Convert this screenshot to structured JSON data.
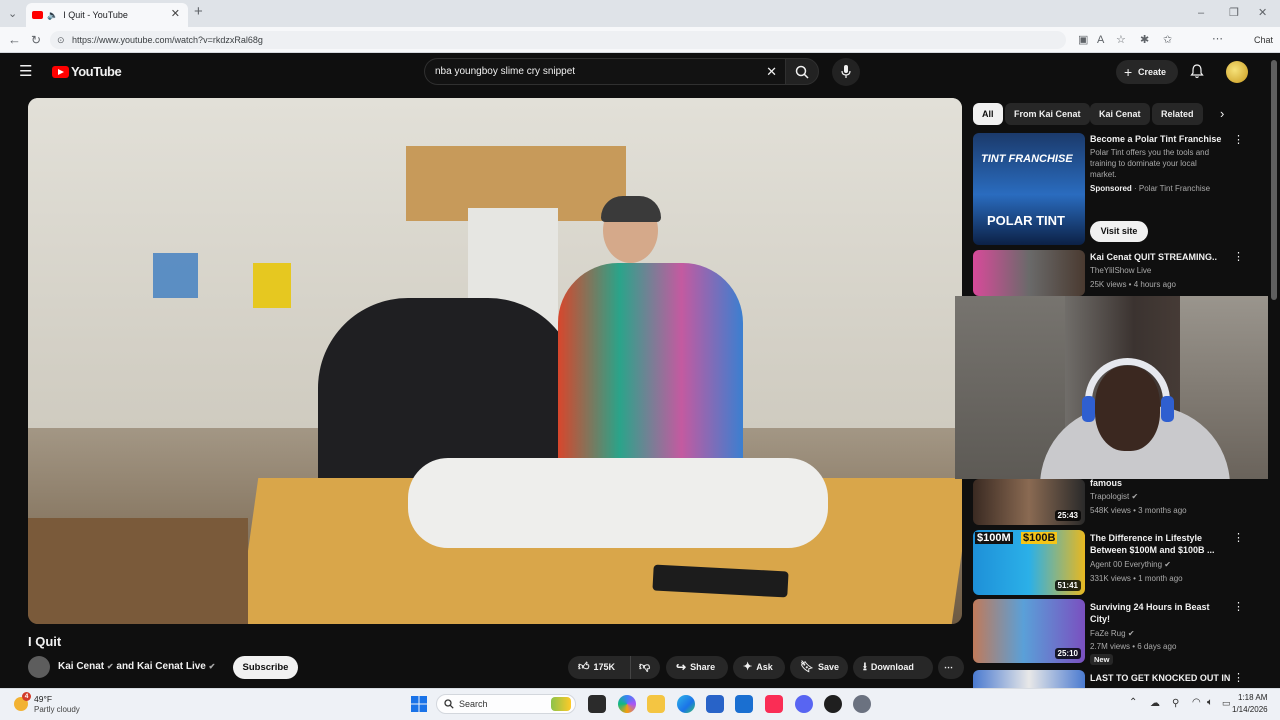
{
  "browser": {
    "tab_title": "I Quit - YouTube",
    "url": "https://www.youtube.com/watch?v=rkdzxRal68g",
    "copilot_label": "Chat"
  },
  "youtube": {
    "logo_text": "YouTube",
    "search_value": "nba youngboy slime cry snippet",
    "create_label": "Create"
  },
  "video": {
    "title": "I Quit",
    "channel": "Kai Cenat",
    "channel_joiner": "and",
    "channel2": "Kai Cenat Live",
    "subscribe_label": "Subscribe",
    "likes": "175K",
    "share_label": "Share",
    "ask_label": "Ask",
    "save_label": "Save",
    "download_label": "Download"
  },
  "chips": [
    "All",
    "From Kai Cenat",
    "Kai Cenat",
    "Related"
  ],
  "ad": {
    "title": "Become a Polar Tint Franchise",
    "description": "Polar Tint offers you the tools and training to dominate your local market.",
    "sponsored": "Sponsored",
    "advertiser": "Polar Tint Franchise",
    "cta": "Visit site",
    "thumb_text_top": "TINT FRANCHISE",
    "thumb_text_bottom": "POLAR TINT"
  },
  "related": [
    {
      "title": "Kai Cenat QUIT STREAMING..",
      "channel": "TheYlilShow Live",
      "meta": "25K views • 4 hours ago"
    },
    {
      "title": "famous",
      "channel": "Trapologist",
      "meta": "548K views • 3 months ago",
      "duration": "25:43"
    },
    {
      "title": "The Difference in Lifestyle Between $100M and $100B ...",
      "channel": "Agent 00 Everything",
      "meta": "331K views • 1 month ago",
      "duration": "51:41",
      "thumb_text_a": "$100M",
      "thumb_text_b": "$100B"
    },
    {
      "title": "Surviving 24 Hours in Beast City!",
      "channel": "FaZe Rug",
      "meta": "2.7M views • 6 days ago",
      "duration": "25:10",
      "badge": "New"
    },
    {
      "title": "LAST TO GET KNOCKED OUT IN",
      "channel": "",
      "meta": ""
    }
  ],
  "taskbar": {
    "weather_temp": "49°F",
    "weather_desc": "Partly cloudy",
    "weather_badge": "4",
    "search_placeholder": "Search",
    "time": "1:18 AM",
    "date": "1/14/2026"
  },
  "colors": {
    "youtube_red": "#ff0000",
    "page_bg": "#0f0f0f",
    "chip_bg": "#272727",
    "active_chip_bg": "#f1f1f1"
  }
}
